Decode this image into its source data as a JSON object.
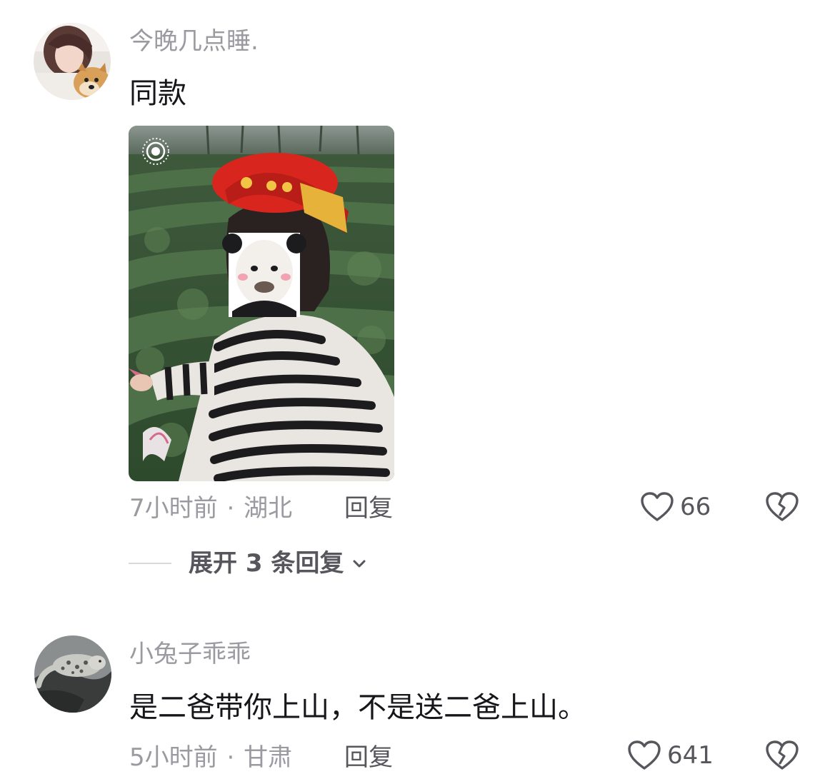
{
  "comments": [
    {
      "username": "今晚几点睡.",
      "text": "同款",
      "time": "7小时前",
      "location": "湖北",
      "reply_label": "回复",
      "likes": "66",
      "avatar_icon": "girl-with-dog-avatar",
      "has_image": true,
      "expand_label": "展开 3 条回复"
    },
    {
      "username": "小兔子乖乖",
      "text": "是二爸带你上山，不是送二爸上山。",
      "time": "5小时前",
      "location": "甘肃",
      "reply_label": "回复",
      "likes": "641",
      "avatar_icon": "snow-leopard-avatar"
    }
  ],
  "meta_separator": "·",
  "colors": {
    "secondary_text": "#9a9aa0",
    "primary_text": "#16161a",
    "action_text": "#56565c",
    "helmet_red": "#d8261f"
  }
}
